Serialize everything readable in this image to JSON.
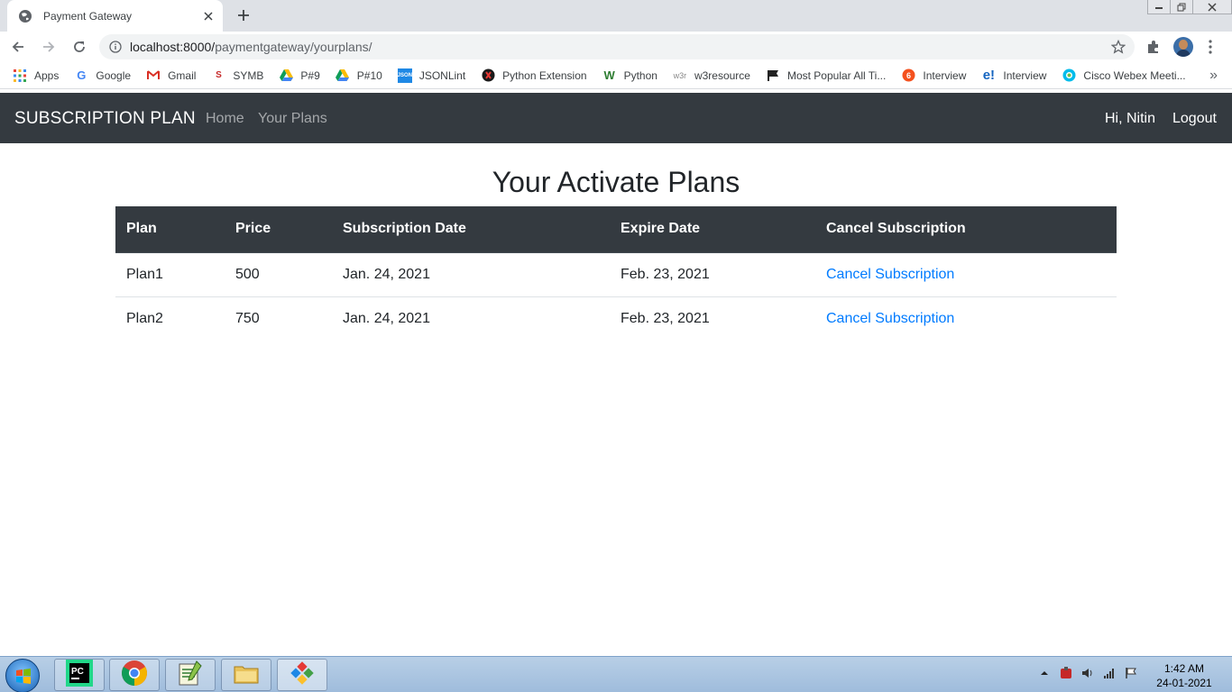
{
  "browser": {
    "tab_title": "Payment Gateway",
    "url_host": "localhost:8000/",
    "url_path": "paymentgateway/yourplans/",
    "bookmarks": [
      {
        "label": "Apps",
        "icon": "apps-grid-icon"
      },
      {
        "label": "Google",
        "icon": "google-icon"
      },
      {
        "label": "Gmail",
        "icon": "gmail-icon"
      },
      {
        "label": "SYMB",
        "icon": "symb-icon"
      },
      {
        "label": "P#9",
        "icon": "drive-icon"
      },
      {
        "label": "P#10",
        "icon": "drive-icon"
      },
      {
        "label": "JSONLint",
        "icon": "json-icon"
      },
      {
        "label": "Python Extension",
        "icon": "python-ext-icon"
      },
      {
        "label": "Python",
        "icon": "w3schools-icon"
      },
      {
        "label": "w3resource",
        "icon": "w3resource-icon"
      },
      {
        "label": "Most Popular All Ti...",
        "icon": "flag-icon"
      },
      {
        "label": "Interview",
        "icon": "interview-icon"
      },
      {
        "label": "Interview",
        "icon": "edureka-icon"
      },
      {
        "label": "Cisco Webex Meeti...",
        "icon": "webex-icon"
      }
    ],
    "bookmark_more": "»"
  },
  "navbar": {
    "brand": "SUBSCRIPTION PLAN",
    "links": [
      "Home",
      "Your Plans"
    ],
    "greeting": "Hi, Nitin",
    "logout": "Logout"
  },
  "main": {
    "title": "Your Activate Plans",
    "columns": [
      "Plan",
      "Price",
      "Subscription Date",
      "Expire Date",
      "Cancel Subscription"
    ],
    "rows": [
      {
        "plan": "Plan1",
        "price": "500",
        "subscription_date": "Jan. 24, 2021",
        "expire_date": "Feb. 23, 2021",
        "action": "Cancel Subscription"
      },
      {
        "plan": "Plan2",
        "price": "750",
        "subscription_date": "Jan. 24, 2021",
        "expire_date": "Feb. 23, 2021",
        "action": "Cancel Subscription"
      }
    ]
  },
  "taskbar": {
    "time": "1:42 AM",
    "date": "24-01-2021"
  },
  "colors": {
    "navbar_bg": "#343a40",
    "link": "#007bff",
    "text": "#212529"
  }
}
